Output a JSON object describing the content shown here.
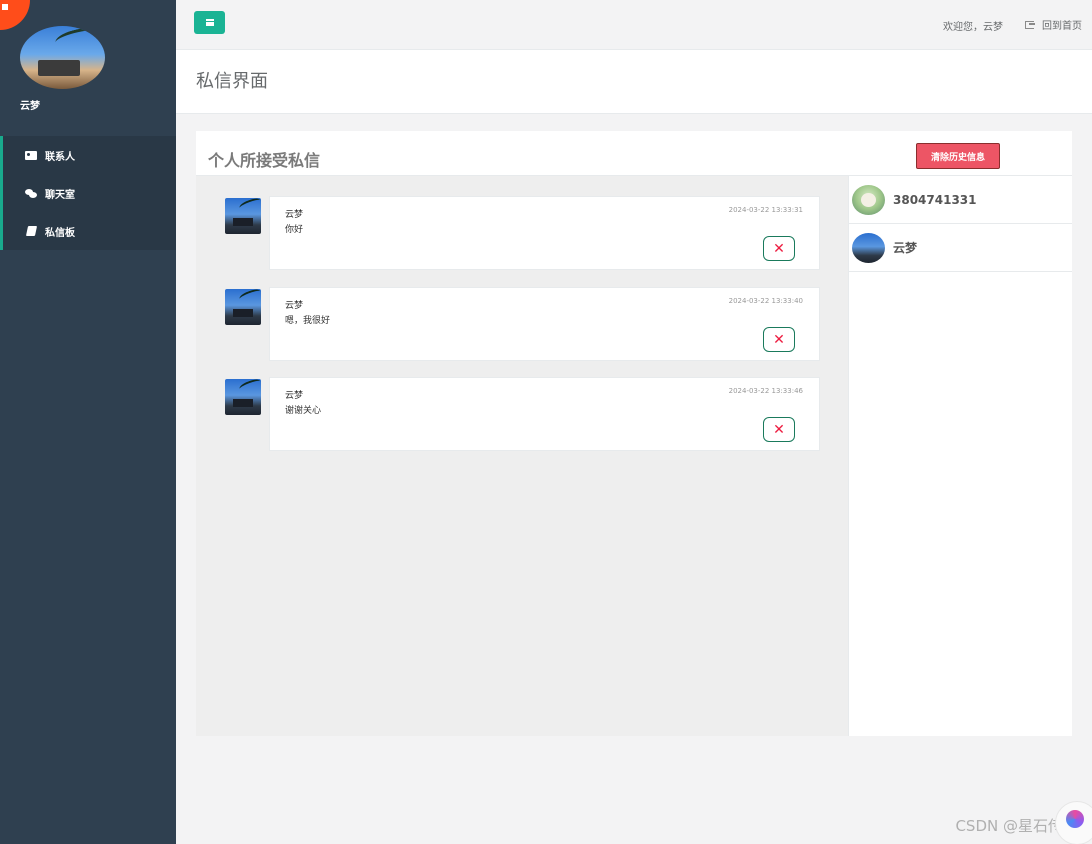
{
  "sidebar": {
    "user_name": "云梦",
    "items": [
      {
        "label": "联系人",
        "icon": "contact-card-icon"
      },
      {
        "label": "聊天室",
        "icon": "chat-bubbles-icon"
      },
      {
        "label": "私信板",
        "icon": "book-icon"
      }
    ]
  },
  "topbar": {
    "menu_icon": "hamburger-icon",
    "welcome": "欢迎您，云梦",
    "home_link": "回到首页",
    "home_icon": "sign-out-icon"
  },
  "page": {
    "title": "私信界面",
    "card_title": "个人所接受私信",
    "clear_button": "清除历史信息"
  },
  "messages": [
    {
      "sender": "云梦",
      "text": "你好",
      "time": "2024-03-22 13:33:31"
    },
    {
      "sender": "云梦",
      "text": "嗯，我很好",
      "time": "2024-03-22 13:33:40"
    },
    {
      "sender": "云梦",
      "text": "谢谢关心",
      "time": "2024-03-22 13:33:46"
    }
  ],
  "delete_symbol": "✕",
  "contacts": [
    {
      "name": "3804741331"
    },
    {
      "name": "云梦"
    }
  ],
  "watermark": "CSDN @星石传说",
  "colors": {
    "sidebar": "#2f4050",
    "accent": "#1ab394",
    "danger": "#ed5565"
  }
}
